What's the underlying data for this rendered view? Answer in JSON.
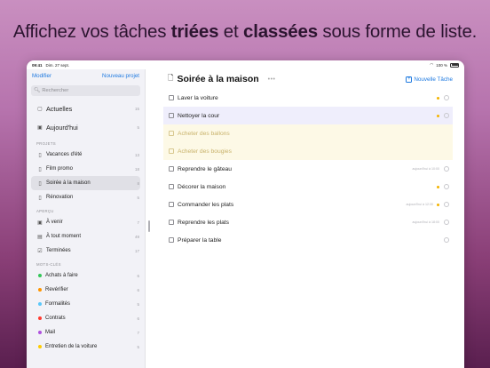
{
  "headline": {
    "part1": "Affichez vos tâches ",
    "bold1": "triées",
    "part2": " et ",
    "bold2": "classées",
    "part3": " sous forme de liste."
  },
  "status": {
    "time": "09:41",
    "date": "Dim. 27 sept.",
    "battery": "100 %"
  },
  "sidebar": {
    "modify": "Modifier",
    "new_project": "Nouveau projet",
    "search_placeholder": "Rechercher",
    "smart": [
      {
        "label": "Actuelles",
        "count": "15",
        "icon": "tray-icon"
      },
      {
        "label": "Aujourd'hui",
        "count": "5",
        "icon": "calendar-icon"
      }
    ],
    "projects_header": "PROJETS",
    "projects": [
      {
        "label": "Vacances d'été",
        "count": "13"
      },
      {
        "label": "Film promo",
        "count": "18"
      },
      {
        "label": "Soirée à la maison",
        "count": "8"
      },
      {
        "label": "Rénovation",
        "count": "5"
      }
    ],
    "overview_header": "APERÇU",
    "overview": [
      {
        "label": "À venir",
        "count": "7",
        "icon": "calendar-icon"
      },
      {
        "label": "À tout moment",
        "count": "49",
        "icon": "inbox-icon"
      },
      {
        "label": "Terminées",
        "count": "17",
        "icon": "check-square-icon"
      }
    ],
    "tags_header": "MOTS-CLÉS",
    "tags": [
      {
        "label": "Achats à faire",
        "count": "6",
        "color": "#34c759"
      },
      {
        "label": "Revérifier",
        "count": "6",
        "color": "#ff9500"
      },
      {
        "label": "Formalités",
        "count": "5",
        "color": "#5ac8fa"
      },
      {
        "label": "Contrats",
        "count": "6",
        "color": "#ff3b30"
      },
      {
        "label": "Mail",
        "count": "7",
        "color": "#af52de"
      },
      {
        "label": "Entretien de la voiture",
        "count": "5",
        "color": "#ffcc00"
      }
    ]
  },
  "main": {
    "title": "Soirée à la maison",
    "ellipsis": "•••",
    "new_task": "Nouvelle Tâche",
    "tasks": [
      {
        "label": "Laver la voiture",
        "meta": "",
        "priority": true,
        "state": "normal"
      },
      {
        "label": "Nettoyer la cour",
        "meta": "",
        "priority": true,
        "state": "selected"
      },
      {
        "label": "Acheter des ballons",
        "meta": "",
        "priority": false,
        "state": "done"
      },
      {
        "label": "Acheter des bougies",
        "meta": "",
        "priority": false,
        "state": "done"
      },
      {
        "label": "Reprendre le gâteau",
        "meta": "aujourd'hui à 10:00",
        "priority": false,
        "state": "normal"
      },
      {
        "label": "Décorer la maison",
        "meta": "",
        "priority": true,
        "state": "normal"
      },
      {
        "label": "Commander les plats",
        "meta": "aujourd'hui à 12:30",
        "priority": true,
        "state": "normal"
      },
      {
        "label": "Reprendre les plats",
        "meta": "aujourd'hui à 18:00",
        "priority": false,
        "state": "normal"
      },
      {
        "label": "Préparer la table",
        "meta": "",
        "priority": false,
        "state": "normal"
      }
    ]
  }
}
